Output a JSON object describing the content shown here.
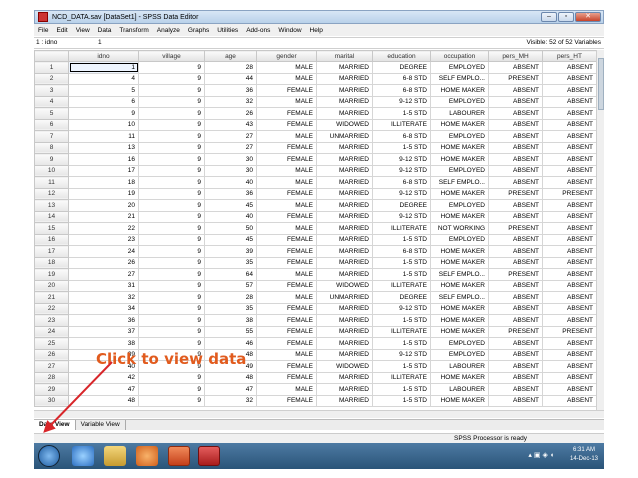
{
  "window": {
    "title": "NCD_DATA.sav [DataSet1] - SPSS Data Editor",
    "min_glyph": "–",
    "max_glyph": "▫",
    "close_glyph": "✕"
  },
  "menu": [
    "File",
    "Edit",
    "View",
    "Data",
    "Transform",
    "Analyze",
    "Graphs",
    "Utilities",
    "Add-ons",
    "Window",
    "Help"
  ],
  "cell_editor": {
    "reference": "1 : idno",
    "value": "1",
    "visible_vars": "Visible: 52 of 52 Variables"
  },
  "grid": {
    "columns": [
      "idno",
      "village",
      "age",
      "gender",
      "marital",
      "education",
      "occupation",
      "pers_MH",
      "pers_HT"
    ],
    "rows": [
      [
        "1",
        "9",
        "28",
        "MALE",
        "MARRIED",
        "DEGREE",
        "EMPLOYED",
        "ABSENT",
        "ABSENT"
      ],
      [
        "4",
        "9",
        "44",
        "MALE",
        "MARRIED",
        "6-8 STD",
        "SELF EMPLO...",
        "PRESENT",
        "ABSENT"
      ],
      [
        "5",
        "9",
        "36",
        "FEMALE",
        "MARRIED",
        "6-8 STD",
        "HOME MAKER",
        "ABSENT",
        "ABSENT"
      ],
      [
        "6",
        "9",
        "32",
        "MALE",
        "MARRIED",
        "9-12 STD",
        "EMPLOYED",
        "ABSENT",
        "ABSENT"
      ],
      [
        "9",
        "9",
        "26",
        "FEMALE",
        "MARRIED",
        "1-5 STD",
        "LABOURER",
        "ABSENT",
        "ABSENT"
      ],
      [
        "10",
        "9",
        "43",
        "FEMALE",
        "WIDOWED",
        "ILLITERATE",
        "HOME MAKER",
        "ABSENT",
        "ABSENT"
      ],
      [
        "11",
        "9",
        "27",
        "MALE",
        "UNMARRIED",
        "6-8 STD",
        "EMPLOYED",
        "ABSENT",
        "ABSENT"
      ],
      [
        "13",
        "9",
        "27",
        "FEMALE",
        "MARRIED",
        "1-5 STD",
        "HOME MAKER",
        "ABSENT",
        "ABSENT"
      ],
      [
        "16",
        "9",
        "30",
        "FEMALE",
        "MARRIED",
        "9-12 STD",
        "HOME MAKER",
        "ABSENT",
        "ABSENT"
      ],
      [
        "17",
        "9",
        "30",
        "MALE",
        "MARRIED",
        "9-12 STD",
        "EMPLOYED",
        "ABSENT",
        "ABSENT"
      ],
      [
        "18",
        "9",
        "40",
        "MALE",
        "MARRIED",
        "6-8 STD",
        "SELF EMPLO...",
        "ABSENT",
        "ABSENT"
      ],
      [
        "19",
        "9",
        "36",
        "FEMALE",
        "MARRIED",
        "9-12 STD",
        "HOME MAKER",
        "PRESENT",
        "PRESENT"
      ],
      [
        "20",
        "9",
        "45",
        "MALE",
        "MARRIED",
        "DEGREE",
        "EMPLOYED",
        "ABSENT",
        "ABSENT"
      ],
      [
        "21",
        "9",
        "40",
        "FEMALE",
        "MARRIED",
        "9-12 STD",
        "HOME MAKER",
        "ABSENT",
        "ABSENT"
      ],
      [
        "22",
        "9",
        "50",
        "MALE",
        "MARRIED",
        "ILLITERATE",
        "NOT WORKING",
        "PRESENT",
        "ABSENT"
      ],
      [
        "23",
        "9",
        "45",
        "FEMALE",
        "MARRIED",
        "1-5 STD",
        "EMPLOYED",
        "ABSENT",
        "ABSENT"
      ],
      [
        "24",
        "9",
        "39",
        "FEMALE",
        "MARRIED",
        "6-8 STD",
        "HOME MAKER",
        "ABSENT",
        "ABSENT"
      ],
      [
        "26",
        "9",
        "35",
        "FEMALE",
        "MARRIED",
        "1-5 STD",
        "HOME MAKER",
        "ABSENT",
        "ABSENT"
      ],
      [
        "27",
        "9",
        "64",
        "MALE",
        "MARRIED",
        "1-5 STD",
        "SELF EMPLO...",
        "PRESENT",
        "ABSENT"
      ],
      [
        "31",
        "9",
        "57",
        "FEMALE",
        "WIDOWED",
        "ILLITERATE",
        "HOME MAKER",
        "ABSENT",
        "ABSENT"
      ],
      [
        "32",
        "9",
        "28",
        "MALE",
        "UNMARRIED",
        "DEGREE",
        "SELF EMPLO...",
        "ABSENT",
        "ABSENT"
      ],
      [
        "34",
        "9",
        "35",
        "FEMALE",
        "MARRIED",
        "9-12 STD",
        "HOME MAKER",
        "ABSENT",
        "ABSENT"
      ],
      [
        "36",
        "9",
        "38",
        "FEMALE",
        "MARRIED",
        "1-5 STD",
        "HOME MAKER",
        "ABSENT",
        "ABSENT"
      ],
      [
        "37",
        "9",
        "55",
        "FEMALE",
        "MARRIED",
        "ILLITERATE",
        "HOME MAKER",
        "PRESENT",
        "PRESENT"
      ],
      [
        "38",
        "9",
        "46",
        "FEMALE",
        "MARRIED",
        "1-5 STD",
        "EMPLOYED",
        "ABSENT",
        "ABSENT"
      ],
      [
        "39",
        "9",
        "48",
        "MALE",
        "MARRIED",
        "9-12 STD",
        "EMPLOYED",
        "ABSENT",
        "ABSENT"
      ],
      [
        "40",
        "9",
        "49",
        "FEMALE",
        "WIDOWED",
        "1-5 STD",
        "LABOURER",
        "ABSENT",
        "ABSENT"
      ],
      [
        "42",
        "9",
        "48",
        "FEMALE",
        "MARRIED",
        "ILLITERATE",
        "HOME MAKER",
        "ABSENT",
        "ABSENT"
      ],
      [
        "47",
        "9",
        "47",
        "MALE",
        "MARRIED",
        "1-5 STD",
        "LABOURER",
        "ABSENT",
        "ABSENT"
      ],
      [
        "48",
        "9",
        "32",
        "FEMALE",
        "MARRIED",
        "1-5 STD",
        "HOME MAKER",
        "ABSENT",
        "ABSENT"
      ]
    ]
  },
  "tabs": [
    "Data View",
    "Variable View"
  ],
  "status": "SPSS  Processor is ready",
  "taskbar": {
    "time": "6:31 AM",
    "date": "14-Dec-13"
  },
  "annotation": "Click to view data",
  "colors": {
    "annotation": "#e15b1e",
    "arrow": "#d8262a"
  }
}
